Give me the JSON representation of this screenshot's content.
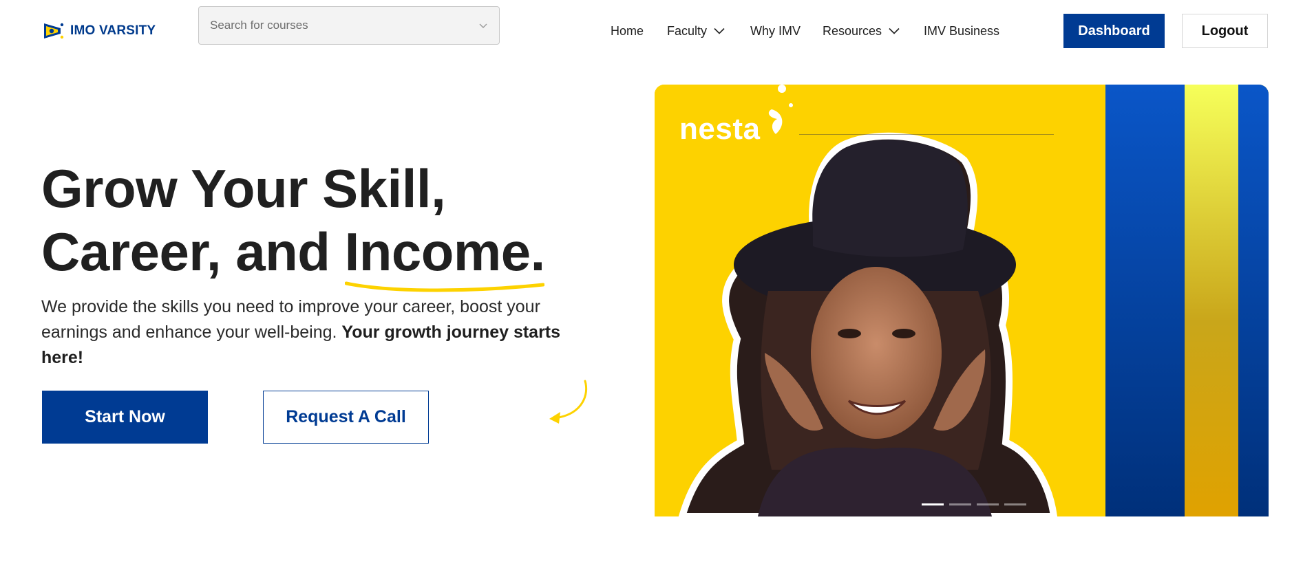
{
  "header": {
    "logo_text": "IMO VARSITY",
    "search": {
      "placeholder": "Search for courses"
    },
    "nav": [
      {
        "label": "Home",
        "has_dropdown": false
      },
      {
        "label": "Faculty",
        "has_dropdown": true
      },
      {
        "label": "Why IMV",
        "has_dropdown": false
      },
      {
        "label": "Resources",
        "has_dropdown": true
      },
      {
        "label": "IMV Business",
        "has_dropdown": false
      }
    ],
    "dashboard_label": "Dashboard",
    "logout_label": "Logout"
  },
  "hero": {
    "title_line1": "Grow Your Skill,",
    "title_line2_prefix": "Career, and ",
    "title_highlight": "Income",
    "title_line2_suffix": ".",
    "description": " We provide the skills you need to improve your career, boost your earnings and enhance your well-being. ",
    "description_bold": "Your growth journey starts here!",
    "start_label": "Start Now",
    "call_label": "Request A Call"
  },
  "banner": {
    "brand_logo": "nesta",
    "slide_count": 4,
    "active_slide": 1
  },
  "colors": {
    "primary": "#003b93",
    "accent_yellow": "#fdd200",
    "text_dark": "#202020"
  },
  "icons": {
    "logo": "imo-varsity-logo-icon",
    "search_caret": "chevron-down-icon",
    "nav_dropdown": "chevron-down-icon",
    "curved_arrow": "curved-arrow-icon"
  }
}
